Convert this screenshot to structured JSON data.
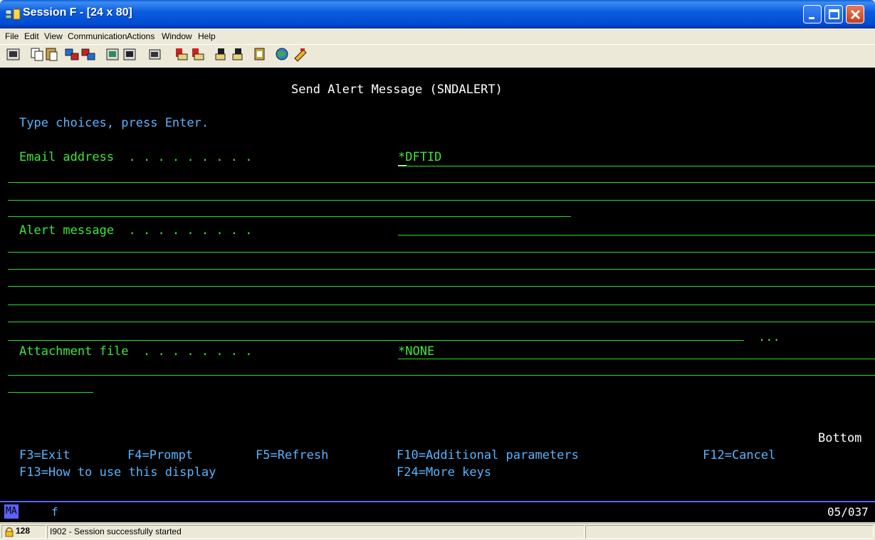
{
  "window": {
    "title": "Session F - [24 x 80]"
  },
  "menu": [
    "File",
    "Edit",
    "View",
    "Communication",
    "Actions",
    "Window",
    "Help"
  ],
  "toolbar": {
    "buttons": [
      "print-screen-icon",
      "copy-icon",
      "paste-icon",
      "send-icon",
      "receive-icon",
      "display-icon",
      "quick-icon",
      "keypad-icon",
      "record-macro-icon",
      "stop-macro-icon",
      "play-macro-icon",
      "macro-play-icon",
      "clipboard-icon",
      "globe-icon",
      "tools-icon"
    ]
  },
  "screen": {
    "heading": "Send Alert Message (SNDALERT)",
    "instructions": "Type choices, press Enter.",
    "email_label": "Email address  . . . . . . . . .",
    "email_value": "*DFTID",
    "alert_label": "Alert message  . . . . . . . . .",
    "more": "...",
    "attachment_label": "Attachment file  . . . . . . . .",
    "attachment_value": "*NONE",
    "bottom": "Bottom",
    "fkeys_row1": {
      "f3": "F3=Exit",
      "f4": "F4=Prompt",
      "f5": "F5=Refresh",
      "f10": "F10=Additional parameters",
      "f12": "F12=Cancel"
    },
    "fkeys_row2": {
      "f13": "F13=How to use this display",
      "f24": "F24=More keys"
    }
  },
  "oia": {
    "mode": "MA",
    "indicator": "f",
    "cursor_pos": "05/037"
  },
  "statusbar": {
    "code": "128",
    "message": "I902 - Session successfully started"
  },
  "colors": {
    "titlebar": "#0b5ee0",
    "terminal_bg": "#000000",
    "field_green": "#3be83b",
    "label_cyan": "#58b4ff"
  }
}
